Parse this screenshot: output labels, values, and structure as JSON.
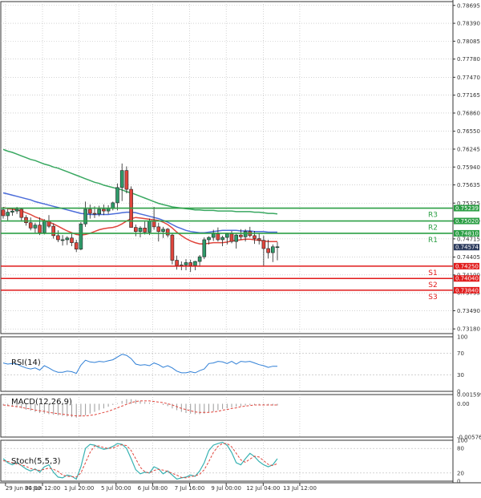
{
  "colors": {
    "bull": "#2f9b6a",
    "bear": "#e0453c",
    "ma_fast": "#e0453c",
    "ma_mid": "#4b6cd9",
    "ma_slow": "#39a861",
    "resistance": "#2c9f45",
    "support": "#e11b1b",
    "rsi_line": "#2f7fd6",
    "macd_hist": "#9a9a9a",
    "macd_signal": "#e0453c",
    "stoch_main": "#38b2b2",
    "stoch_signal": "#e0453c",
    "grid": "#b8b8b8",
    "current_price_bg": "#2b3a5c"
  },
  "chart_data": [
    {
      "type": "candlestick",
      "name": "price",
      "y_ticks": [
        "0.78695",
        "0.78390",
        "0.78085",
        "0.77780",
        "0.77470",
        "0.77165",
        "0.76860",
        "0.76550",
        "0.76245",
        "0.75940",
        "0.75635",
        "0.75325",
        "0.75020",
        "0.74715",
        "0.74405",
        "0.74100",
        "0.73795",
        "0.73490",
        "0.73180"
      ],
      "y_tick_values": [
        0.78695,
        0.7839,
        0.78085,
        0.7778,
        0.7747,
        0.77165,
        0.7686,
        0.7655,
        0.76245,
        0.7594,
        0.75635,
        0.75325,
        0.7502,
        0.74715,
        0.74405,
        0.741,
        0.73795,
        0.7349,
        0.7318
      ],
      "ylim": [
        0.731,
        0.7876
      ],
      "x_ticks": [
        "29 Jun 04:00",
        "30 Jun 12:00",
        "1 Jul 20:00",
        "5 Jul 00:00",
        "6 Jul 08:00",
        "7 Jul 16:00",
        "9 Jul 00:00",
        "12 Jul 04:00",
        "13 Jul 12:00"
      ],
      "x_tick_positions": [
        0.5,
        8.6,
        16.6,
        24.7,
        32.7,
        40.8,
        48.8,
        56.9,
        64.9
      ],
      "candles": [
        [
          0.7521,
          0.7526,
          0.7506,
          0.7511
        ],
        [
          0.7511,
          0.7522,
          0.7503,
          0.7517
        ],
        [
          0.7517,
          0.7524,
          0.7511,
          0.7519
        ],
        [
          0.7519,
          0.7526,
          0.7514,
          0.7522
        ],
        [
          0.7522,
          0.7524,
          0.7501,
          0.7508
        ],
        [
          0.7508,
          0.7512,
          0.7494,
          0.7499
        ],
        [
          0.7499,
          0.7508,
          0.7486,
          0.749
        ],
        [
          0.749,
          0.7499,
          0.7482,
          0.7495
        ],
        [
          0.7495,
          0.7508,
          0.7478,
          0.7482
        ],
        [
          0.7482,
          0.7505,
          0.7479,
          0.7502
        ],
        [
          0.7502,
          0.7512,
          0.749,
          0.7493
        ],
        [
          0.7493,
          0.7498,
          0.7472,
          0.7477
        ],
        [
          0.7477,
          0.7486,
          0.7466,
          0.747
        ],
        [
          0.747,
          0.7478,
          0.746,
          0.747
        ],
        [
          0.747,
          0.7476,
          0.7461,
          0.7473
        ],
        [
          0.7473,
          0.7481,
          0.7459,
          0.7465
        ],
        [
          0.7465,
          0.747,
          0.7449,
          0.7454
        ],
        [
          0.7454,
          0.75,
          0.7452,
          0.7497
        ],
        [
          0.7497,
          0.7535,
          0.7492,
          0.7522
        ],
        [
          0.7522,
          0.753,
          0.7506,
          0.7515
        ],
        [
          0.7515,
          0.7527,
          0.7507,
          0.7514
        ],
        [
          0.7514,
          0.7528,
          0.751,
          0.7522
        ],
        [
          0.7522,
          0.753,
          0.7512,
          0.7519
        ],
        [
          0.7519,
          0.7529,
          0.7514,
          0.7523
        ],
        [
          0.7523,
          0.7535,
          0.752,
          0.7533
        ],
        [
          0.7533,
          0.7566,
          0.752,
          0.7559
        ],
        [
          0.7559,
          0.76,
          0.7536,
          0.7588
        ],
        [
          0.7588,
          0.7595,
          0.7549,
          0.7556
        ],
        [
          0.7556,
          0.7561,
          0.7509,
          0.7491
        ],
        [
          0.7491,
          0.7496,
          0.7476,
          0.7484
        ],
        [
          0.7484,
          0.7493,
          0.7474,
          0.749
        ],
        [
          0.749,
          0.7501,
          0.7479,
          0.7483
        ],
        [
          0.7483,
          0.7506,
          0.7478,
          0.7502
        ],
        [
          0.7502,
          0.7526,
          0.7487,
          0.7492
        ],
        [
          0.7492,
          0.7499,
          0.7467,
          0.7484
        ],
        [
          0.7484,
          0.7492,
          0.7473,
          0.7488
        ],
        [
          0.7488,
          0.749,
          0.7474,
          0.7478
        ],
        [
          0.7478,
          0.7481,
          0.7428,
          0.7435
        ],
        [
          0.7435,
          0.7443,
          0.7419,
          0.7426
        ],
        [
          0.7426,
          0.7433,
          0.7418,
          0.7427
        ],
        [
          0.7427,
          0.7437,
          0.7418,
          0.7431
        ],
        [
          0.7431,
          0.7436,
          0.7415,
          0.7426
        ],
        [
          0.7426,
          0.7434,
          0.7418,
          0.7433
        ],
        [
          0.7433,
          0.7444,
          0.7424,
          0.7441
        ],
        [
          0.7441,
          0.7474,
          0.7437,
          0.747
        ],
        [
          0.747,
          0.7476,
          0.7462,
          0.7474
        ],
        [
          0.7474,
          0.7487,
          0.7468,
          0.748
        ],
        [
          0.748,
          0.7491,
          0.7467,
          0.747
        ],
        [
          0.747,
          0.7477,
          0.7459,
          0.7474
        ],
        [
          0.7474,
          0.7482,
          0.7462,
          0.748
        ],
        [
          0.748,
          0.7485,
          0.7464,
          0.7467
        ],
        [
          0.7467,
          0.748,
          0.7455,
          0.7478
        ],
        [
          0.7478,
          0.7488,
          0.747,
          0.7475
        ],
        [
          0.7475,
          0.7488,
          0.7467,
          0.7484
        ],
        [
          0.7484,
          0.7492,
          0.7474,
          0.7477
        ],
        [
          0.7477,
          0.7485,
          0.7463,
          0.7472
        ],
        [
          0.7472,
          0.7481,
          0.7462,
          0.7469
        ],
        [
          0.7469,
          0.7477,
          0.7425,
          0.7455
        ],
        [
          0.7455,
          0.747,
          0.7438,
          0.7448
        ],
        [
          0.7448,
          0.7462,
          0.7432,
          0.7458
        ],
        [
          0.7458,
          0.7466,
          0.7435,
          0.7458
        ]
      ],
      "ma_fast": [
        0.7525,
        0.7523,
        0.7522,
        0.7521,
        0.7519,
        0.7516,
        0.7513,
        0.7509,
        0.7506,
        0.7503,
        0.75,
        0.7497,
        0.7493,
        0.7489,
        0.7485,
        0.7482,
        0.7479,
        0.7478,
        0.7479,
        0.7481,
        0.7484,
        0.7487,
        0.7489,
        0.749,
        0.7491,
        0.7493,
        0.7497,
        0.7502,
        0.7506,
        0.7508,
        0.7507,
        0.7506,
        0.7505,
        0.7504,
        0.7503,
        0.75,
        0.7496,
        0.749,
        0.7483,
        0.7477,
        0.7472,
        0.7468,
        0.7465,
        0.7463,
        0.7463,
        0.7464,
        0.7465,
        0.7465,
        0.7465,
        0.7466,
        0.7468,
        0.7469,
        0.747,
        0.7471,
        0.7471,
        0.747,
        0.7469,
        0.7468,
        0.7467,
        0.7467,
        0.7467
      ],
      "ma_mid": [
        0.755,
        0.7548,
        0.7546,
        0.7544,
        0.7542,
        0.754,
        0.7538,
        0.7535,
        0.7533,
        0.7531,
        0.7529,
        0.7527,
        0.7525,
        0.7523,
        0.7521,
        0.7519,
        0.7517,
        0.7515,
        0.7514,
        0.7513,
        0.7513,
        0.7513,
        0.7513,
        0.7513,
        0.7514,
        0.7515,
        0.7516,
        0.7517,
        0.7517,
        0.7516,
        0.7514,
        0.7512,
        0.751,
        0.7508,
        0.7506,
        0.7503,
        0.75,
        0.7496,
        0.7492,
        0.7489,
        0.7486,
        0.7484,
        0.7483,
        0.7482,
        0.7482,
        0.7483,
        0.7484,
        0.7485,
        0.7486,
        0.7486,
        0.7486,
        0.7486,
        0.7485,
        0.7485,
        0.7485,
        0.7484,
        0.7484,
        0.7484,
        0.7483,
        0.7483,
        0.7483
      ],
      "ma_slow": [
        0.7624,
        0.7621,
        0.7619,
        0.7616,
        0.7613,
        0.761,
        0.7607,
        0.7605,
        0.7602,
        0.7599,
        0.7597,
        0.7594,
        0.7592,
        0.7589,
        0.7586,
        0.7583,
        0.758,
        0.7577,
        0.7574,
        0.7571,
        0.7568,
        0.7566,
        0.7563,
        0.7561,
        0.7559,
        0.7557,
        0.7555,
        0.7552,
        0.755,
        0.7547,
        0.7544,
        0.7541,
        0.7538,
        0.7535,
        0.7532,
        0.753,
        0.7528,
        0.7526,
        0.7525,
        0.7524,
        0.7523,
        0.7522,
        0.7521,
        0.7521,
        0.752,
        0.752,
        0.752,
        0.7519,
        0.7519,
        0.7519,
        0.7519,
        0.7518,
        0.7518,
        0.7518,
        0.7518,
        0.7517,
        0.7517,
        0.7516,
        0.7515,
        0.7515,
        0.7514
      ],
      "levels": [
        {
          "name": "R3",
          "price": 0.75239,
          "price_label": "0.75239",
          "kind": "resistance"
        },
        {
          "name": "R2",
          "price": 0.7502,
          "price_label": "0.75020",
          "kind": "resistance"
        },
        {
          "name": "R1",
          "price": 0.7481,
          "price_label": "0.74810",
          "kind": "resistance"
        },
        {
          "name": "S1",
          "price": 0.7425,
          "price_label": "0.74250",
          "kind": "support"
        },
        {
          "name": "S2",
          "price": 0.7404,
          "price_label": "0.74040",
          "kind": "support"
        },
        {
          "name": "S3",
          "price": 0.7384,
          "price_label": "0.73840",
          "kind": "support"
        }
      ],
      "current_price": {
        "value": 0.74574,
        "label": "0.74574"
      }
    },
    {
      "type": "line",
      "name": "RSI(14)",
      "title": "RSI(14)",
      "ylim": [
        0,
        100
      ],
      "y_ticks": [
        "100",
        "70",
        "30",
        "0"
      ],
      "y_tick_values": [
        100,
        70,
        30,
        0
      ],
      "levels": [
        70,
        30
      ],
      "values": [
        52,
        50,
        51,
        50,
        46,
        43,
        41,
        43,
        39,
        47,
        43,
        38,
        35,
        35,
        37,
        36,
        33,
        48,
        57,
        54,
        53,
        55,
        54,
        56,
        58,
        63,
        68,
        66,
        60,
        50,
        48,
        49,
        47,
        52,
        49,
        44,
        47,
        43,
        37,
        34,
        34,
        36,
        34,
        38,
        41,
        51,
        52,
        55,
        54,
        51,
        55,
        50,
        55,
        54,
        55,
        52,
        49,
        47,
        44,
        46,
        46
      ]
    },
    {
      "type": "bar+line",
      "name": "MACD(12,26,9)",
      "title": "MACD(12,26,9)",
      "ylim": [
        -0.00576,
        0.0016
      ],
      "y_ticks": [
        "0.001599",
        "0.00",
        "-0.005765"
      ],
      "y_tick_values": [
        0.001599,
        0.0,
        -0.005765
      ],
      "histogram": [
        -0.0003,
        -0.0004,
        -0.0005,
        -0.0006,
        -0.0008,
        -0.001,
        -0.0012,
        -0.0014,
        -0.0016,
        -0.0017,
        -0.0018,
        -0.0019,
        -0.002,
        -0.0021,
        -0.0022,
        -0.0023,
        -0.0024,
        -0.0022,
        -0.002,
        -0.0017,
        -0.0014,
        -0.0011,
        -0.0008,
        -0.0005,
        -0.0002,
        0.0001,
        0.0005,
        0.0008,
        0.0008,
        0.0007,
        0.0005,
        0.0003,
        0.0002,
        0.0001,
        0.0,
        -0.0002,
        -0.0004,
        -0.0008,
        -0.0011,
        -0.0014,
        -0.0016,
        -0.0017,
        -0.0018,
        -0.0018,
        -0.0017,
        -0.0015,
        -0.0013,
        -0.0011,
        -0.0009,
        -0.0008,
        -0.0006,
        -0.0005,
        -0.0004,
        -0.0003,
        -0.0002,
        -0.0002,
        -0.0002,
        -0.0002,
        -0.0003,
        -0.0003,
        -0.0003
      ],
      "signal": [
        -0.0002,
        -0.0003,
        -0.0004,
        -0.0005,
        -0.0006,
        -0.0008,
        -0.0009,
        -0.0011,
        -0.0012,
        -0.0013,
        -0.0015,
        -0.0016,
        -0.0017,
        -0.0018,
        -0.0019,
        -0.002,
        -0.0021,
        -0.0021,
        -0.0021,
        -0.002,
        -0.0019,
        -0.0017,
        -0.0015,
        -0.0013,
        -0.001,
        -0.0007,
        -0.0004,
        -0.0001,
        0.0002,
        0.0004,
        0.0005,
        0.0005,
        0.0005,
        0.0004,
        0.0003,
        0.0002,
        0.0,
        -0.0002,
        -0.0005,
        -0.0008,
        -0.001,
        -0.0012,
        -0.0014,
        -0.0015,
        -0.0015,
        -0.0015,
        -0.0014,
        -0.0013,
        -0.0011,
        -0.001,
        -0.0008,
        -0.0007,
        -0.0005,
        -0.0004,
        -0.0003,
        -0.0002,
        -0.0002,
        -0.0002,
        -0.0002,
        -0.0002,
        -0.0002
      ]
    },
    {
      "type": "line",
      "name": "Stoch(5,5,3)",
      "title": "Stoch(5,5,3)",
      "ylim": [
        0,
        100
      ],
      "y_ticks": [
        "100",
        "80",
        "20",
        "0"
      ],
      "y_tick_values": [
        100,
        80,
        20,
        0
      ],
      "levels": [
        80,
        20
      ],
      "main": [
        55,
        45,
        40,
        45,
        38,
        30,
        25,
        30,
        22,
        35,
        40,
        22,
        10,
        8,
        15,
        12,
        5,
        35,
        80,
        90,
        88,
        82,
        78,
        80,
        85,
        92,
        90,
        80,
        55,
        28,
        18,
        22,
        20,
        35,
        30,
        18,
        25,
        15,
        5,
        8,
        10,
        15,
        12,
        25,
        45,
        75,
        88,
        92,
        95,
        88,
        70,
        45,
        40,
        55,
        68,
        60,
        48,
        40,
        35,
        40,
        55
      ],
      "signal": [
        50,
        48,
        45,
        42,
        40,
        36,
        31,
        28,
        26,
        29,
        32,
        29,
        24,
        15,
        12,
        11,
        10,
        20,
        45,
        70,
        86,
        86,
        82,
        80,
        81,
        86,
        89,
        87,
        75,
        55,
        34,
        23,
        20,
        26,
        29,
        27,
        24,
        19,
        15,
        9,
        8,
        11,
        13,
        17,
        28,
        48,
        70,
        85,
        92,
        92,
        84,
        68,
        52,
        46,
        54,
        61,
        59,
        50,
        41,
        38,
        43
      ]
    }
  ]
}
